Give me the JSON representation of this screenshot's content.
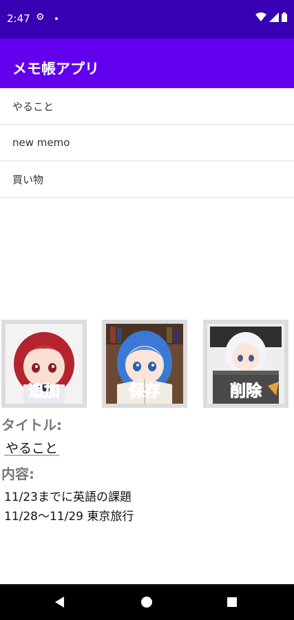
{
  "status_bar": {
    "time": "2:47"
  },
  "app_bar": {
    "title": "メモ帳アプリ"
  },
  "memo_list": [
    {
      "title": "やること"
    },
    {
      "title": "new memo"
    },
    {
      "title": "買い物"
    }
  ],
  "buttons": {
    "add_label": "追加",
    "save_label": "保存",
    "delete_label": "削除"
  },
  "form": {
    "title_label": "タイトル:",
    "title_value": "やること",
    "content_label": "内容:",
    "content_value": "11/23までに英語の課題\n11/28～11/29 東京旅行"
  },
  "colors": {
    "status_bar": "#3700B3",
    "app_bar": "#6200EE",
    "add_label": "#e53935",
    "save_label": "#5aa3e6",
    "delete_label": "#9e9e9e"
  },
  "icons": [
    "gear-icon",
    "wifi-icon",
    "signal-icon",
    "battery-icon",
    "back-icon",
    "home-icon",
    "recents-icon"
  ]
}
